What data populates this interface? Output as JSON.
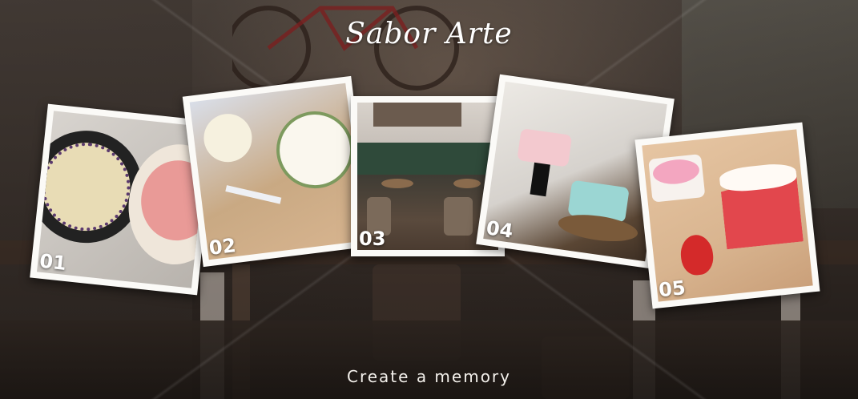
{
  "brand": {
    "name": "Sabor Arte"
  },
  "tagline": "Create a memory",
  "gallery": {
    "photos": [
      {
        "number": "01",
        "subject": "cake-plates-photo"
      },
      {
        "number": "02",
        "subject": "finally-cake-photo"
      },
      {
        "number": "03",
        "subject": "cafe-people-photo"
      },
      {
        "number": "04",
        "subject": "birthday-cakes-photo"
      },
      {
        "number": "05",
        "subject": "strawberry-cake-slice-photo"
      }
    ]
  },
  "colors": {
    "frame": "#fbfaf7",
    "text": "#ffffff",
    "background": "#2a2420"
  }
}
